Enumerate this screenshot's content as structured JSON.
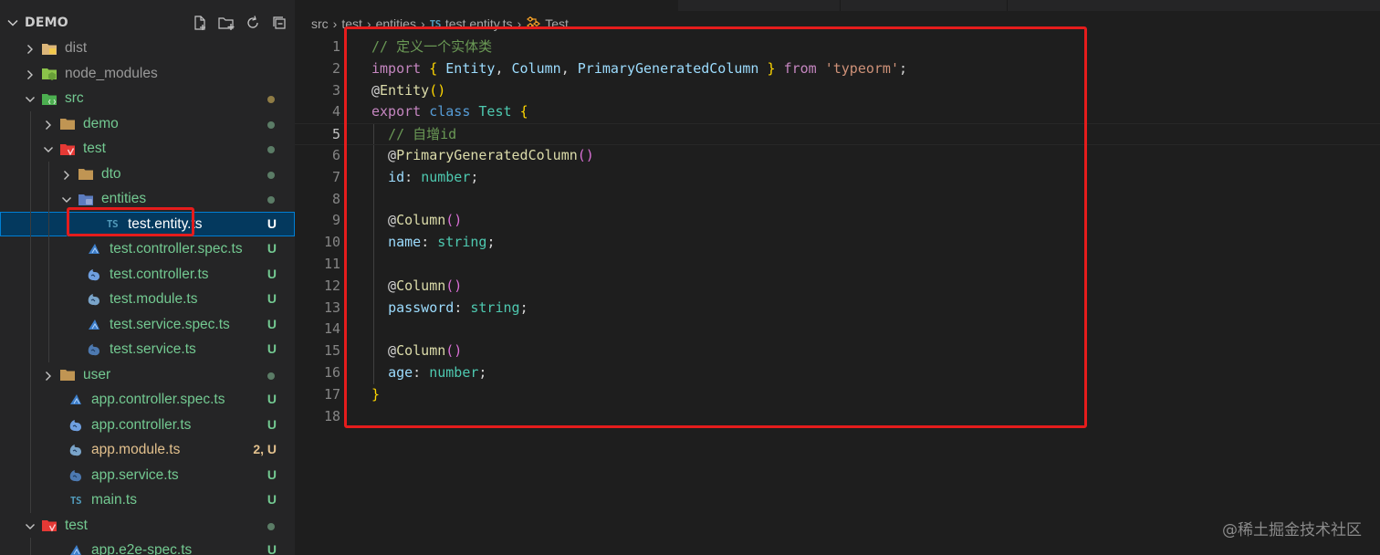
{
  "explorer": {
    "title": "DEMO",
    "actions": [
      "new-file-icon",
      "new-folder-icon",
      "refresh-icon",
      "collapse-all-icon"
    ],
    "items": [
      {
        "label": "dist",
        "kind": "folder",
        "depth": 0,
        "expanded": false,
        "icon": "folder-dist-icon",
        "status": ""
      },
      {
        "label": "node_modules",
        "kind": "folder",
        "depth": 0,
        "expanded": false,
        "icon": "folder-node-icon",
        "status": ""
      },
      {
        "label": "src",
        "kind": "folder",
        "depth": 0,
        "expanded": true,
        "icon": "folder-src-icon",
        "status": "dot",
        "color": "green"
      },
      {
        "label": "demo",
        "kind": "folder",
        "depth": 1,
        "expanded": false,
        "icon": "folder-icon",
        "status": "dot",
        "color": "green"
      },
      {
        "label": "test",
        "kind": "folder",
        "depth": 1,
        "expanded": true,
        "icon": "folder-test-icon",
        "status": "dot",
        "color": "green"
      },
      {
        "label": "dto",
        "kind": "folder",
        "depth": 2,
        "expanded": false,
        "icon": "folder-icon",
        "status": "dot",
        "color": "green"
      },
      {
        "label": "entities",
        "kind": "folder",
        "depth": 2,
        "expanded": true,
        "icon": "folder-entities-icon",
        "status": "dot",
        "color": "green"
      },
      {
        "label": "test.entity.ts",
        "kind": "file",
        "depth": 3,
        "icon": "typescript-icon",
        "status": "U",
        "color": "plain",
        "selected": true
      },
      {
        "label": "test.controller.spec.ts",
        "kind": "file",
        "depth": 2,
        "icon": "nest-spec-icon",
        "status": "U",
        "color": "green"
      },
      {
        "label": "test.controller.ts",
        "kind": "file",
        "depth": 2,
        "icon": "nest-controller-icon",
        "status": "U",
        "color": "green"
      },
      {
        "label": "test.module.ts",
        "kind": "file",
        "depth": 2,
        "icon": "nest-module-icon",
        "status": "U",
        "color": "green"
      },
      {
        "label": "test.service.spec.ts",
        "kind": "file",
        "depth": 2,
        "icon": "nest-spec-icon",
        "status": "U",
        "color": "green"
      },
      {
        "label": "test.service.ts",
        "kind": "file",
        "depth": 2,
        "icon": "nest-service-icon",
        "status": "U",
        "color": "green"
      },
      {
        "label": "user",
        "kind": "folder",
        "depth": 1,
        "expanded": false,
        "icon": "folder-icon",
        "status": "dot",
        "color": "green"
      },
      {
        "label": "app.controller.spec.ts",
        "kind": "file",
        "depth": 1,
        "icon": "nest-spec-icon",
        "status": "U",
        "color": "green"
      },
      {
        "label": "app.controller.ts",
        "kind": "file",
        "depth": 1,
        "icon": "nest-controller-icon",
        "status": "U",
        "color": "green"
      },
      {
        "label": "app.module.ts",
        "kind": "file",
        "depth": 1,
        "icon": "nest-module-icon",
        "status": "2, U",
        "color": "yellow"
      },
      {
        "label": "app.service.ts",
        "kind": "file",
        "depth": 1,
        "icon": "nest-service-icon",
        "status": "U",
        "color": "green"
      },
      {
        "label": "main.ts",
        "kind": "file",
        "depth": 1,
        "icon": "typescript-icon",
        "status": "U",
        "color": "green"
      },
      {
        "label": "test",
        "kind": "folder",
        "depth": 0,
        "expanded": true,
        "icon": "folder-test-icon",
        "status": "dot",
        "color": "green"
      },
      {
        "label": "app.e2e-spec.ts",
        "kind": "file",
        "depth": 1,
        "icon": "nest-spec-icon",
        "status": "U",
        "color": "green"
      }
    ]
  },
  "breadcrumb": {
    "parts": [
      "src",
      "test",
      "entities"
    ],
    "file_badge": "TS",
    "file": "test.entity.ts",
    "symbol": "Test"
  },
  "editor": {
    "current_line": 5,
    "lines": [
      {
        "n": "1",
        "indent": 0,
        "tokens": [
          [
            "cm",
            "// 定义一个实体类"
          ]
        ]
      },
      {
        "n": "2",
        "indent": 0,
        "tokens": [
          [
            "kw",
            "import"
          ],
          [
            "pl",
            " "
          ],
          [
            "br1",
            "{"
          ],
          [
            "pl",
            " "
          ],
          [
            "var",
            "Entity"
          ],
          [
            "pl",
            ", "
          ],
          [
            "var",
            "Column"
          ],
          [
            "pl",
            ", "
          ],
          [
            "var",
            "PrimaryGeneratedColumn"
          ],
          [
            "pl",
            " "
          ],
          [
            "br1",
            "}"
          ],
          [
            "pl",
            " "
          ],
          [
            "kw",
            "from"
          ],
          [
            "pl",
            " "
          ],
          [
            "str",
            "'typeorm'"
          ],
          [
            "pl",
            ";"
          ]
        ]
      },
      {
        "n": "3",
        "indent": 0,
        "tokens": [
          [
            "pl",
            "@"
          ],
          [
            "fn",
            "Entity"
          ],
          [
            "br1",
            "()"
          ]
        ]
      },
      {
        "n": "4",
        "indent": 0,
        "tokens": [
          [
            "kw",
            "export"
          ],
          [
            "pl",
            " "
          ],
          [
            "st",
            "class"
          ],
          [
            "pl",
            " "
          ],
          [
            "cls",
            "Test"
          ],
          [
            "pl",
            " "
          ],
          [
            "br1",
            "{"
          ]
        ]
      },
      {
        "n": "5",
        "indent": 1,
        "tokens": [
          [
            "pl",
            "  "
          ],
          [
            "cm",
            "// 自增id"
          ]
        ]
      },
      {
        "n": "6",
        "indent": 1,
        "tokens": [
          [
            "pl",
            "  @"
          ],
          [
            "fn",
            "PrimaryGeneratedColumn"
          ],
          [
            "br2",
            "()"
          ]
        ]
      },
      {
        "n": "7",
        "indent": 1,
        "tokens": [
          [
            "pl",
            "  "
          ],
          [
            "var",
            "id"
          ],
          [
            "pl",
            ": "
          ],
          [
            "cls",
            "number"
          ],
          [
            "pl",
            ";"
          ]
        ]
      },
      {
        "n": "8",
        "indent": 1,
        "tokens": []
      },
      {
        "n": "9",
        "indent": 1,
        "tokens": [
          [
            "pl",
            "  @"
          ],
          [
            "fn",
            "Column"
          ],
          [
            "br2",
            "()"
          ]
        ]
      },
      {
        "n": "10",
        "indent": 1,
        "tokens": [
          [
            "pl",
            "  "
          ],
          [
            "var",
            "name"
          ],
          [
            "pl",
            ": "
          ],
          [
            "cls",
            "string"
          ],
          [
            "pl",
            ";"
          ]
        ]
      },
      {
        "n": "11",
        "indent": 1,
        "tokens": []
      },
      {
        "n": "12",
        "indent": 1,
        "tokens": [
          [
            "pl",
            "  @"
          ],
          [
            "fn",
            "Column"
          ],
          [
            "br2",
            "()"
          ]
        ]
      },
      {
        "n": "13",
        "indent": 1,
        "tokens": [
          [
            "pl",
            "  "
          ],
          [
            "var",
            "password"
          ],
          [
            "pl",
            ": "
          ],
          [
            "cls",
            "string"
          ],
          [
            "pl",
            ";"
          ]
        ]
      },
      {
        "n": "14",
        "indent": 1,
        "tokens": []
      },
      {
        "n": "15",
        "indent": 1,
        "tokens": [
          [
            "pl",
            "  @"
          ],
          [
            "fn",
            "Column"
          ],
          [
            "br2",
            "()"
          ]
        ]
      },
      {
        "n": "16",
        "indent": 1,
        "tokens": [
          [
            "pl",
            "  "
          ],
          [
            "var",
            "age"
          ],
          [
            "pl",
            ": "
          ],
          [
            "cls",
            "number"
          ],
          [
            "pl",
            ";"
          ]
        ]
      },
      {
        "n": "17",
        "indent": 0,
        "tokens": [
          [
            "br1",
            "}"
          ]
        ]
      },
      {
        "n": "18",
        "indent": 0,
        "tokens": []
      }
    ]
  },
  "watermark": "@稀土掘金技术社区",
  "colors": {
    "highlight_box": "#e51c1c",
    "untracked": "#73c991",
    "modified": "#e2c08d",
    "selection": "#04395e"
  }
}
